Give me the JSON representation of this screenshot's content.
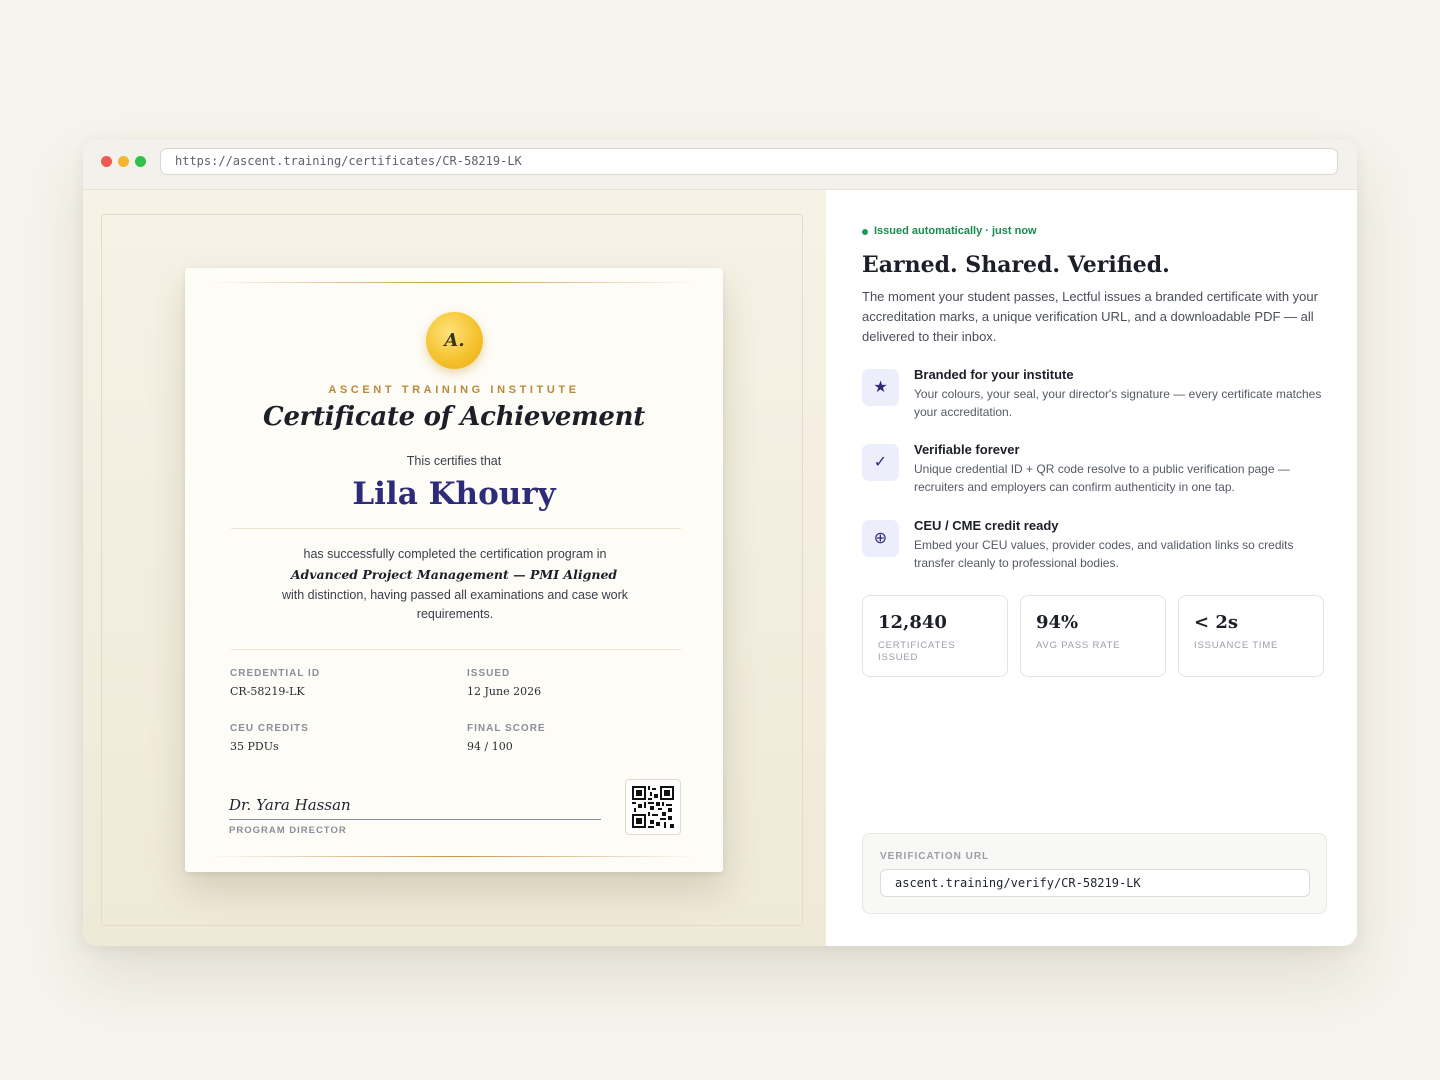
{
  "browser": {
    "url": "https://ascent.training/certificates/CR-58219-LK"
  },
  "certificate": {
    "seal_text": "A.",
    "institute": "ASCENT TRAINING INSTITUTE",
    "title": "Certificate of Achievement",
    "certifies": "This certifies that",
    "recipient": "Lila Khoury",
    "completed_text": "has successfully completed the certification program in",
    "program": "Advanced Project Management — PMI Aligned",
    "distinction_text": "with distinction, having passed all examinations and case work requirements.",
    "fields": [
      {
        "label": "CREDENTIAL ID",
        "value": "CR-58219-LK"
      },
      {
        "label": "ISSUED",
        "value": "12 June 2026"
      },
      {
        "label": "CEU CREDITS",
        "value": "35 PDUs"
      },
      {
        "label": "FINAL SCORE",
        "value": "94 / 100"
      }
    ],
    "signature": "Dr. Yara Hassan",
    "signature_role": "PROGRAM DIRECTOR",
    "qr_icon": "qr-code-icon"
  },
  "panel": {
    "status": "Issued automatically · just now",
    "status_color": "#1a9a56",
    "headline": "Earned. Shared. Verified.",
    "intro": "The moment your student passes, Lectful issues a branded certificate with your accreditation marks, a unique verification URL, and a downloadable PDF — all delivered to their inbox.",
    "features": [
      {
        "icon": "star-icon",
        "glyph": "★",
        "title": "Branded for your institute",
        "desc": "Your colours, your seal, your director's signature — every certificate matches your accreditation."
      },
      {
        "icon": "check-icon",
        "glyph": "✓",
        "title": "Verifiable forever",
        "desc": "Unique credential ID + QR code resolve to a public verification page — recruiters and employers can confirm authenticity in one tap."
      },
      {
        "icon": "plus-circle-icon",
        "glyph": "⊕",
        "title": "CEU / CME credit ready",
        "desc": "Embed your CEU values, provider codes, and validation links so credits transfer cleanly to professional bodies."
      }
    ],
    "stats": [
      {
        "value": "12,840",
        "label": "CERTIFICATES ISSUED"
      },
      {
        "value": "94%",
        "label": "AVG PASS RATE"
      },
      {
        "value": "< 2s",
        "label": "ISSUANCE TIME"
      }
    ],
    "verification": {
      "label": "VERIFICATION URL",
      "value": "ascent.training/verify/CR-58219-LK"
    }
  },
  "colors": {
    "accent": "#2e2b78",
    "gold": "#c4964a",
    "background": "#f6f3ec"
  }
}
